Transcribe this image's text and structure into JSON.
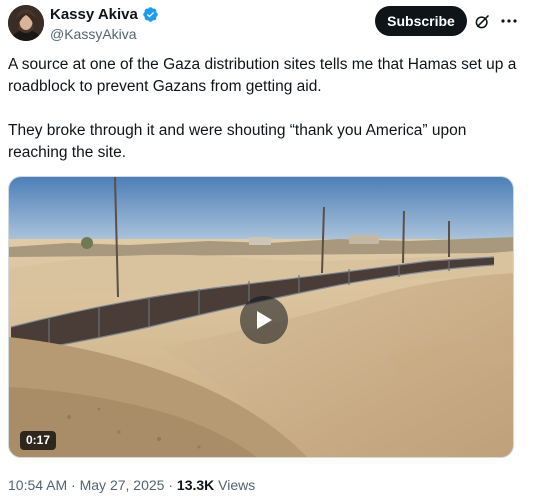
{
  "author": {
    "display_name": "Kassy Akiva",
    "handle": "@KassyAkiva",
    "verified": true,
    "verified_color": "#1d9bf0"
  },
  "actions": {
    "subscribe_label": "Subscribe",
    "grok_icon": "grok-icon",
    "more_icon": "more-icon"
  },
  "tweet": {
    "text": "A source at one of the Gaza distribution sites tells me that Hamas set up a roadblock to prevent Gazans from getting aid.\n\nThey broke through it and were shouting “thank you America” upon reaching the site."
  },
  "media": {
    "type": "video",
    "duration": "0:17",
    "play_icon": "play-icon"
  },
  "meta": {
    "time": "10:54 AM",
    "separator": "·",
    "date": "May 27, 2025",
    "views_count": "13.3K",
    "views_label": "Views"
  }
}
